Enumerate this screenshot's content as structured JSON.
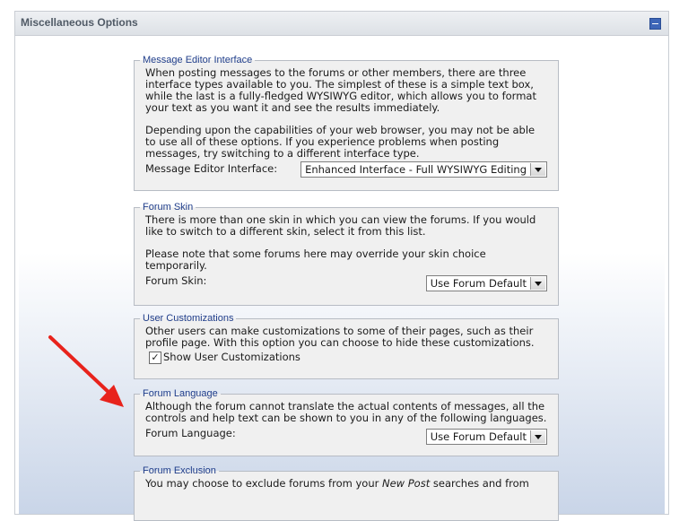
{
  "panel": {
    "title": "Miscellaneous Options"
  },
  "fieldsets": {
    "editor": {
      "legend": "Message Editor Interface",
      "para1": "When posting messages to the forums or other members, there are three interface types available to you. The simplest of these is a simple text box, while the last is a fully-fledged WYSIWYG editor, which allows you to format your text as you want it and see the results immediately.",
      "para2": "Depending upon the capabilities of your web browser, you may not be able to use all of these options. If you experience problems when posting messages, try switching to a different interface type.",
      "field_label": "Message Editor Interface:",
      "selected": "Enhanced Interface - Full WYSIWYG Editing"
    },
    "skin": {
      "legend": "Forum Skin",
      "para1": "There is more than one skin in which you can view the forums. If you would like to switch to a different skin, select it from this list.",
      "para2": "Please note that some forums here may override your skin choice temporarily.",
      "field_label": "Forum Skin:",
      "selected": "Use Forum Default"
    },
    "custom": {
      "legend": "User Customizations",
      "para1": "Other users can make customizations to some of their pages, such as their profile page. With this option you can choose to hide these customizations.",
      "checkbox_label": "Show User Customizations",
      "checked": true
    },
    "language": {
      "legend": "Forum Language",
      "para1": "Although the forum cannot translate the actual contents of messages, all the controls and help text can be shown to you in any of the following languages.",
      "field_label": "Forum Language:",
      "selected": "Use Forum Default"
    },
    "exclusion": {
      "legend": "Forum Exclusion",
      "para1_pre": "You may choose to exclude forums from your ",
      "para1_em": "New Post",
      "para1_post": " searches and from"
    }
  },
  "colors": {
    "legend": "#1f3d8a",
    "annotation_arrow": "#e8231c",
    "collapse_button": "#3d66b8"
  },
  "icons": {
    "collapse": "minus-square-icon",
    "dropdown": "chevron-down-icon",
    "check": "checkmark-icon",
    "annotation": "red-arrow-icon"
  }
}
